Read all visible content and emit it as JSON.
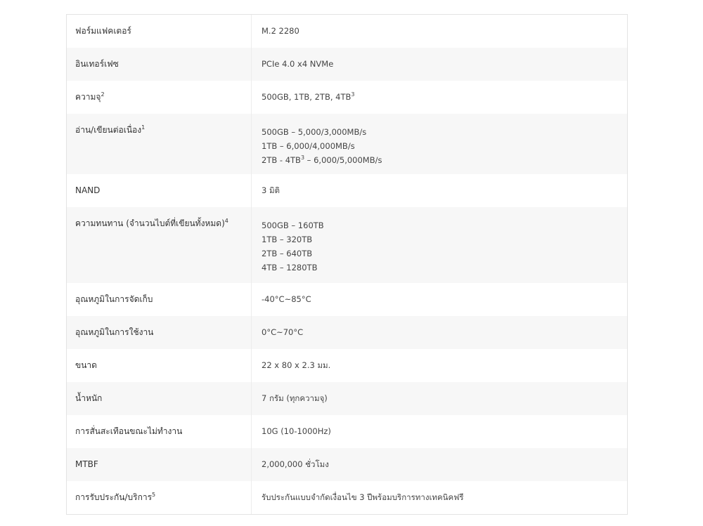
{
  "rows": [
    {
      "label": "ฟอร์มแฟคเตอร์",
      "label_sup": "",
      "lines": [
        [
          "M.2 2280",
          ""
        ]
      ]
    },
    {
      "label": "อินเทอร์เฟซ",
      "label_sup": "",
      "lines": [
        [
          "PCIe 4.0 x4 NVMe",
          ""
        ]
      ]
    },
    {
      "label": "ความจุ",
      "label_sup": "2",
      "lines": [
        [
          "500GB, 1TB, 2TB, 4TB",
          "3"
        ]
      ]
    },
    {
      "label": "อ่าน/เขียนต่อเนื่อง",
      "label_sup": "1",
      "lines": [
        [
          "500GB – 5,000/3,000MB/s",
          ""
        ],
        [
          "1TB – 6,000/4,000MB/s",
          ""
        ],
        [
          "2TB - 4TB",
          "3",
          " – 6,000/5,000MB/s"
        ]
      ]
    },
    {
      "label": "NAND",
      "label_sup": "",
      "lines": [
        [
          "3 มิติ",
          ""
        ]
      ]
    },
    {
      "label": "ความทนทาน (จำนวนไบต์ที่เขียนทั้งหมด)",
      "label_sup": "4",
      "lines": [
        [
          "500GB – 160TB",
          ""
        ],
        [
          "1TB – 320TB",
          ""
        ],
        [
          "2TB – 640TB",
          ""
        ],
        [
          "4TB – 1280TB",
          ""
        ]
      ]
    },
    {
      "label": "อุณหภูมิในการจัดเก็บ",
      "label_sup": "",
      "lines": [
        [
          "-40°C~85°C",
          ""
        ]
      ]
    },
    {
      "label": "อุณหภูมิในการใช้งาน",
      "label_sup": "",
      "lines": [
        [
          "0°C~70°C",
          ""
        ]
      ]
    },
    {
      "label": "ขนาด",
      "label_sup": "",
      "lines": [
        [
          "22 x 80 x 2.3 มม.",
          ""
        ]
      ]
    },
    {
      "label": "น้ำหนัก",
      "label_sup": "",
      "lines": [
        [
          "7 กรัม (ทุกความจุ)",
          ""
        ]
      ]
    },
    {
      "label": "การสั่นสะเทือนขณะไม่ทำงาน",
      "label_sup": "",
      "lines": [
        [
          "10G (10-1000Hz)",
          ""
        ]
      ]
    },
    {
      "label": "MTBF",
      "label_sup": "",
      "lines": [
        [
          "2,000,000 ชั่วโมง",
          ""
        ]
      ]
    },
    {
      "label": "การรับประกัน/บริการ",
      "label_sup": "5",
      "lines": [
        [
          "รับประกันแบบจำกัดเงื่อนไข 3 ปีพร้อมบริการทางเทคนิคฟรี",
          ""
        ]
      ]
    }
  ]
}
